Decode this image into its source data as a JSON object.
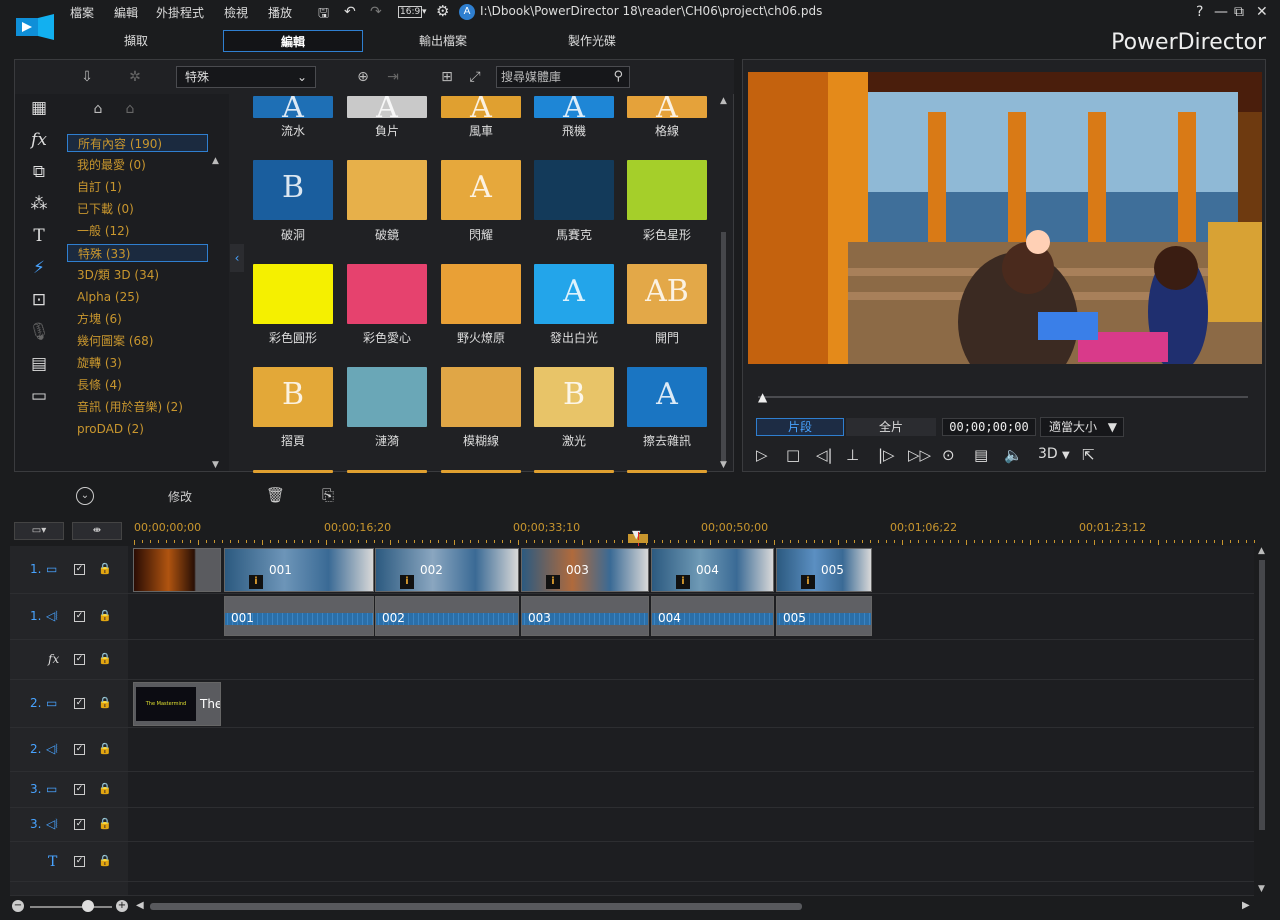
{
  "menu": [
    "檔案",
    "編輯",
    "外掛程式",
    "檢視",
    "播放"
  ],
  "file_path": "I:\\Dbook\\PowerDirector 18\\reader\\CH06\\project\\ch06.pds",
  "aspect": "16:9",
  "window_buttons": [
    "?",
    "—",
    "⧉",
    "✕"
  ],
  "mode_tabs": [
    "擷取",
    "編輯",
    "輸出檔案",
    "製作光碟"
  ],
  "brand": "PowerDirector",
  "library": {
    "filter_value": "特殊",
    "search_placeholder": "搜尋媒體庫",
    "categories": [
      "所有內容 (190)",
      "我的最愛 (0)",
      "自訂 (1)",
      "已下載 (0)",
      "一般 (12)",
      "特殊 (33)",
      "3D/類 3D (34)",
      "Alpha (25)",
      "方塊 (6)",
      "幾何圖案 (68)",
      "旋轉 (3)",
      "長條 (4)",
      "音訊 (用於音樂) (2)",
      "proDAD (2)"
    ],
    "row1_labels": [
      "流水",
      "負片",
      "風車",
      "飛機",
      "格線"
    ],
    "row2_labels": [
      "破洞",
      "破鏡",
      "閃耀",
      "馬賽克",
      "彩色星形"
    ],
    "row3_labels": [
      "彩色圓形",
      "彩色愛心",
      "野火燎原",
      "發出白光",
      "開門"
    ],
    "row4_labels": [
      "摺頁",
      "漣漪",
      "模糊線",
      "激光",
      "擦去雜訊"
    ]
  },
  "preview": {
    "segment": "片段",
    "full": "全片",
    "timecode": "00;00;00;00",
    "fit": "適當大小",
    "three_d": "3D"
  },
  "timeline": {
    "modify": "修改",
    "ticks": [
      "00;00;00;00",
      "00;00;16;20",
      "00;00;33;10",
      "00;00;50;00",
      "00;01;06;22",
      "00;01;23;12"
    ],
    "track_numbers": [
      "1.",
      "1.",
      "2.",
      "2.",
      "3.",
      "3."
    ],
    "video_clips": [
      "001",
      "002",
      "003",
      "004",
      "005"
    ],
    "audio_clips": [
      "001",
      "002",
      "003",
      "004",
      "005"
    ],
    "title_clip": "The",
    "title_thumb_text": "The Mastermind"
  },
  "colors": {
    "accent": "#2f7fd0",
    "category_text": "#c8962e",
    "playhead": "#e32626"
  }
}
